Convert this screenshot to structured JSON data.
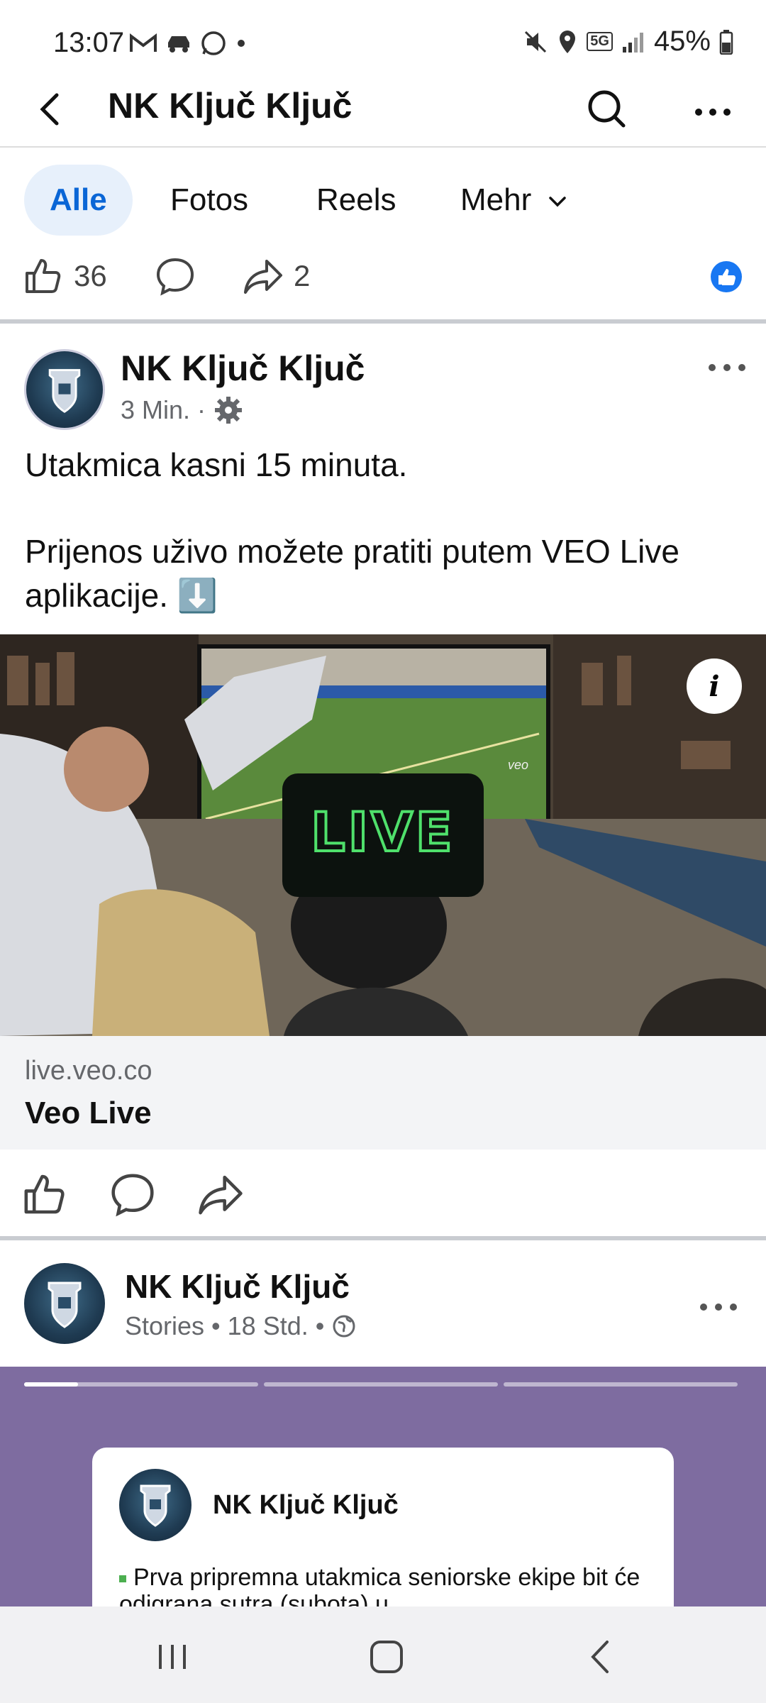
{
  "status_bar": {
    "time": "13:07",
    "network": "5G",
    "battery": "45%"
  },
  "app_bar": {
    "title": "NK Ključ Ključ"
  },
  "tabs": [
    {
      "label": "Alle",
      "active": true
    },
    {
      "label": "Fotos",
      "active": false
    },
    {
      "label": "Reels",
      "active": false
    },
    {
      "label": "Mehr",
      "active": false
    }
  ],
  "prev_post_reactions": {
    "likes": "36",
    "shares": "2"
  },
  "post": {
    "author": "NK Ključ Ključ",
    "time": "3 Min. ·",
    "text_line1": "Utakmica kasni 15 minuta.",
    "text_line2": "Prijenos uživo možete pratiti putem VEO Live aplikacije. ⬇️",
    "media_badge": "LIVE",
    "media_watermark": "veo",
    "info_label": "i",
    "link_domain": "live.veo.co",
    "link_title": "Veo Live"
  },
  "stories_post": {
    "author": "NK Ključ Ključ",
    "meta": "Stories • 18 Std. •",
    "story_card_name": "NK Ključ Ključ",
    "story_card_text": "Prva pripremna utakmica seniorske ekipe bit će odigrana sutra (subota) u",
    "progress_segments": 3,
    "first_segment_progress": 0.23
  },
  "colors": {
    "accent": "#0a66d6",
    "tab_active_bg": "#e7f0fb",
    "stories_bg": "#7e6ca0",
    "live_green": "#4fe06b"
  }
}
